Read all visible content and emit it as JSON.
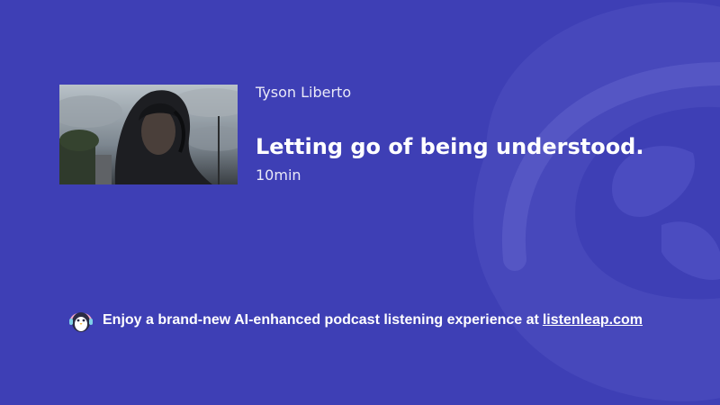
{
  "background_color": "#3e3fb5",
  "background_logo_icon": "listenleap-headphones-logo-watermark",
  "episode": {
    "cover_image": "hooded-person-cloudy-sky-photo",
    "author": "Tyson Liberto",
    "title": "Letting go of being understood.",
    "duration": "10min"
  },
  "promo": {
    "icon": "penguin-headphones-icon",
    "text": "Enjoy a brand-new AI-enhanced podcast listening experience at",
    "link_text": "listenleap.com"
  }
}
